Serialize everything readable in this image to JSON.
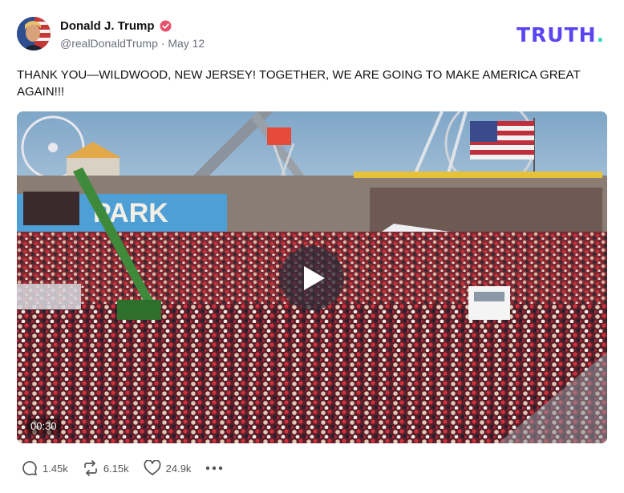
{
  "post": {
    "author_name": "Donald J. Trump",
    "handle": "@realDonaldTrump",
    "separator": "·",
    "date": "May 12",
    "text": "THANK YOU—WILDWOOD, NEW JERSEY! TOGETHER, WE ARE GOING TO MAKE AMERICA GREAT AGAIN!!!",
    "verified_color": "#e8516b"
  },
  "brand": {
    "logo_main": "TRUTH",
    "logo_dot": ".",
    "color": "#5b45f2",
    "dot_color": "#2fd6b8"
  },
  "video": {
    "duration": "00:30",
    "sign_text": "PARK",
    "icons": {
      "play": "play-icon"
    }
  },
  "actions": {
    "replies": "1.45k",
    "retruths": "6.15k",
    "likes": "24.9k",
    "icons": [
      "comment-icon",
      "retruth-icon",
      "heart-icon",
      "more-icon"
    ]
  }
}
